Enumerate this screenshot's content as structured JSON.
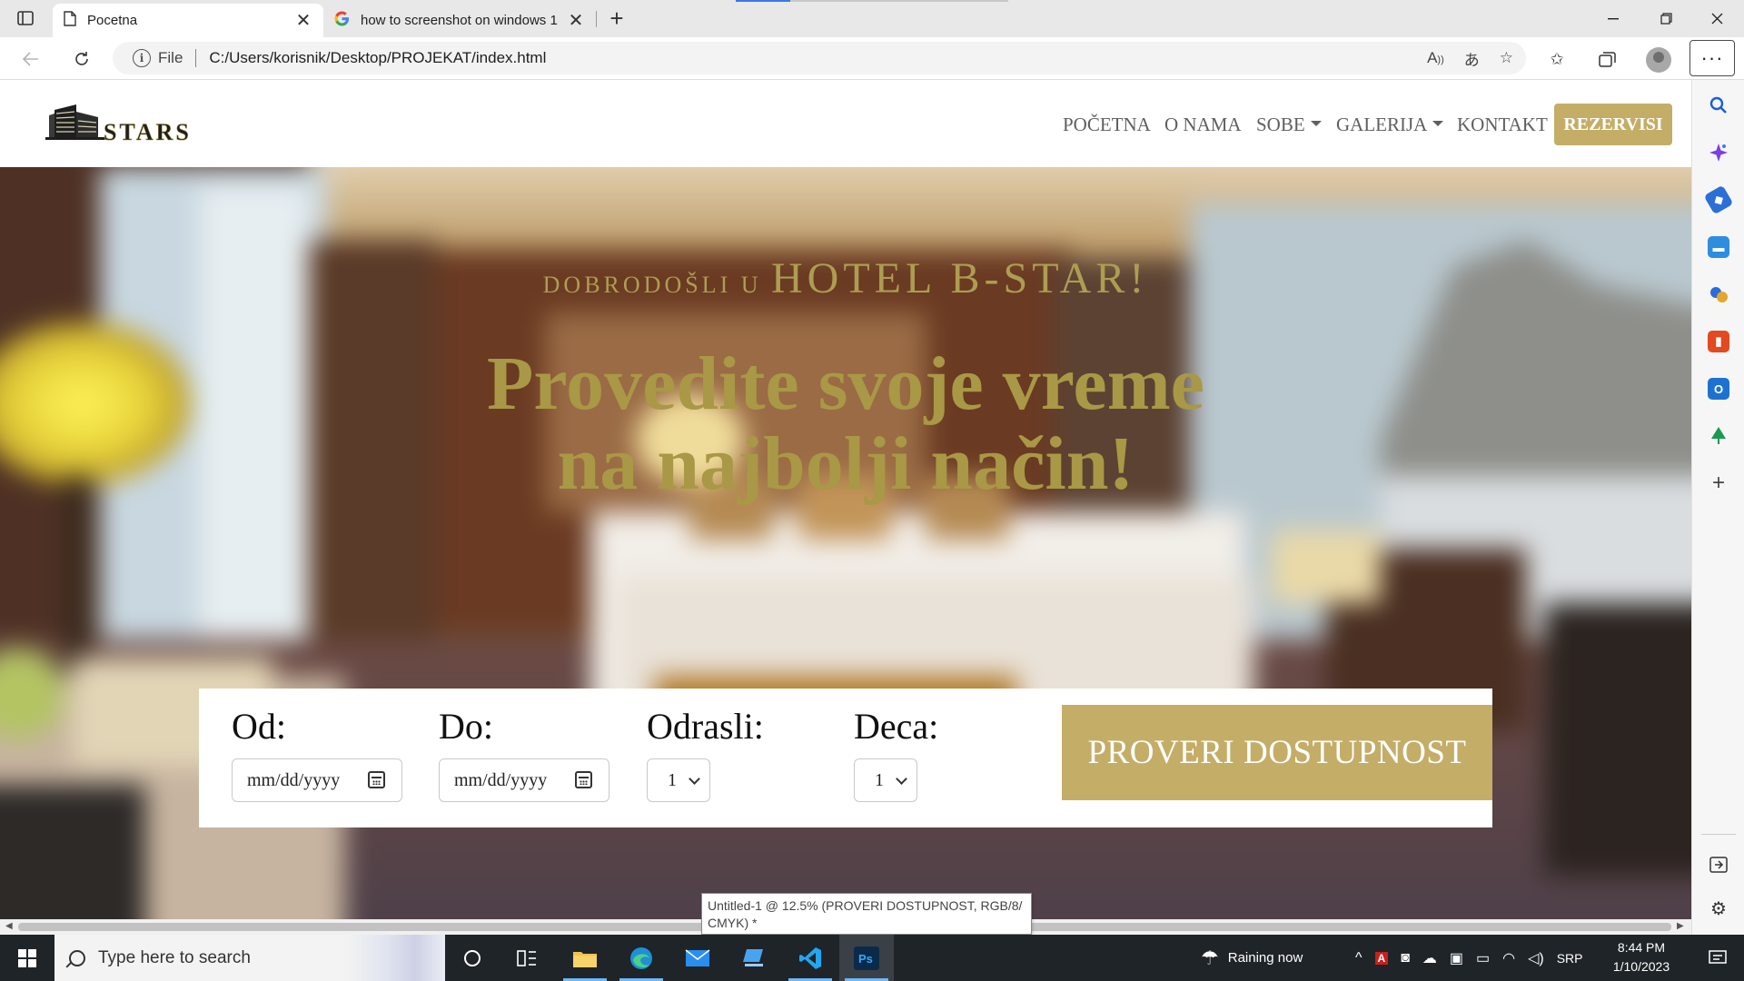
{
  "browser": {
    "tabs": [
      {
        "title": "Pocetna",
        "active": true
      },
      {
        "title": "how to screenshot on windows 1",
        "active": false
      }
    ],
    "address": {
      "scheme_label": "File",
      "url": "C:/Users/korisnik/Desktop/PROJEKAT/index.html"
    }
  },
  "site": {
    "logo_text": "STARS",
    "nav": [
      "POČETNA",
      "O NAMA",
      "SOBE",
      "GALERIJA",
      "KONTAKT"
    ],
    "nav_dropdowns": [
      "SOBE",
      "GALERIJA"
    ],
    "reserve_label": "REZERVISI",
    "hero": {
      "welcome_small": "DOBRODOŠLI U",
      "welcome_big": "HOTEL B-STAR!",
      "headline_line1": "Provedite svoje vreme",
      "headline_line2": "na najbolji način!"
    },
    "booking": {
      "from_label": "Od:",
      "to_label": "Do:",
      "adults_label": "Odrasli:",
      "kids_label": "Deca:",
      "date_placeholder": "mm/dd/yyyy",
      "adults_value": "1",
      "kids_value": "1",
      "check_label": "PROVERI DOSTUPNOST"
    },
    "colors": {
      "accent": "#c4ad67",
      "hero_text": "#ad9d52"
    }
  },
  "tooltip": "Untitled-1 @ 12.5% (PROVERI  DOSTUPNOST, RGB/8/ CMYK) *",
  "taskbar": {
    "search_placeholder": "Type here to search",
    "weather": "Raining now",
    "language": "SRP",
    "time": "8:44 PM",
    "date": "1/10/2023"
  }
}
